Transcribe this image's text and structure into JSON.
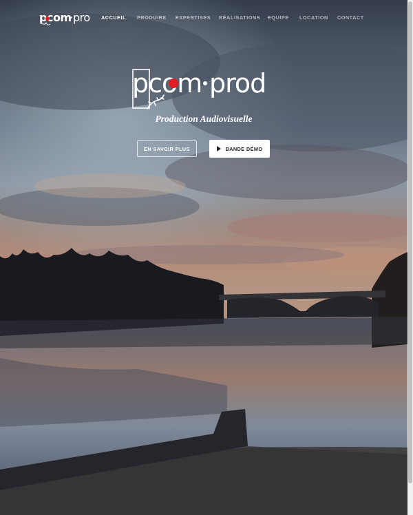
{
  "nav": {
    "logo_text": "pcom·prod",
    "items": [
      {
        "label": "ACCUEIL",
        "active": true
      },
      {
        "label": "PRODUIRE",
        "active": false
      },
      {
        "label": "EXPERTISES",
        "active": false
      },
      {
        "label": "RÉALISATIONS",
        "active": false
      },
      {
        "label": "EQUIPE",
        "active": false
      },
      {
        "label": "LOCATION",
        "active": false
      },
      {
        "label": "CONTACT",
        "active": false
      }
    ]
  },
  "hero": {
    "brand_logo_text": "pcom·prod",
    "tagline": "Production Audiovisuelle",
    "buttons": {
      "learn_more": "EN SAVOIR PLUS",
      "demo": "BANDE DÉMO"
    }
  },
  "colors": {
    "accent_red": "#e11d26",
    "text_white": "#ffffff",
    "button_text_dark": "#222222"
  },
  "icons": [
    "play-icon",
    "lizard-icon"
  ]
}
